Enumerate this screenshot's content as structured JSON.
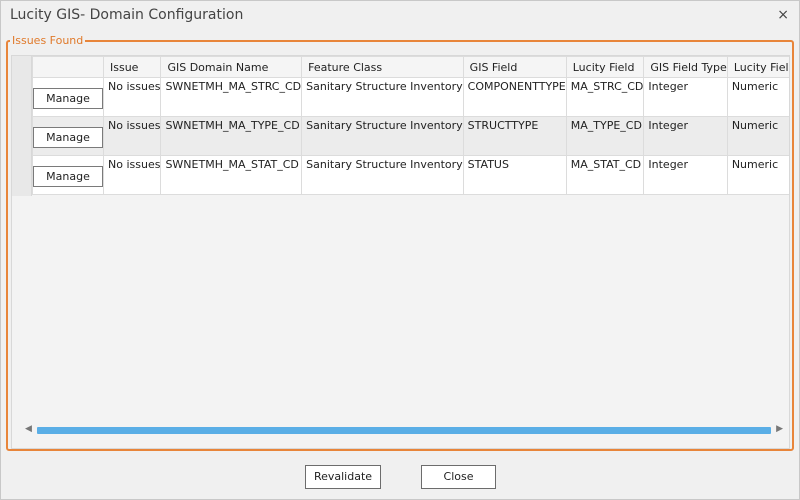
{
  "window": {
    "title": "Lucity GIS- Domain Configuration",
    "close_glyph": "×"
  },
  "group": {
    "legend": "Issues Found"
  },
  "table": {
    "columns": [
      "",
      "Issue",
      "GIS Domain Name",
      "Feature Class",
      "GIS Field",
      "Lucity Field",
      "GIS Field Type",
      "Lucity Field Type"
    ],
    "rows": [
      {
        "action": "Manage",
        "issue": "No issues",
        "gis_domain": "SWNETMH_MA_STRC_CD",
        "feature_class": "Sanitary Structure Inventory",
        "gis_field": "COMPONENTTYPE",
        "lucity_field": "MA_STRC_CD",
        "gis_field_type": "Integer",
        "lucity_field_type": "Numeric"
      },
      {
        "action": "Manage",
        "issue": "No issues",
        "gis_domain": "SWNETMH_MA_TYPE_CD",
        "feature_class": "Sanitary Structure Inventory",
        "gis_field": "STRUCTTYPE",
        "lucity_field": "MA_TYPE_CD",
        "gis_field_type": "Integer",
        "lucity_field_type": "Numeric"
      },
      {
        "action": "Manage",
        "issue": "No issues",
        "gis_domain": "SWNETMH_MA_STAT_CD",
        "feature_class": "Sanitary Structure Inventory",
        "gis_field": "STATUS",
        "lucity_field": "MA_STAT_CD",
        "gis_field_type": "Integer",
        "lucity_field_type": "Numeric"
      }
    ]
  },
  "scrollbar": {
    "left_arrow": "◀",
    "right_arrow": "▶"
  },
  "footer": {
    "revalidate_label": "Revalidate",
    "close_label": "Close"
  },
  "colors": {
    "group_border": "#e8853a",
    "scroll_thumb": "#5aaee6"
  }
}
